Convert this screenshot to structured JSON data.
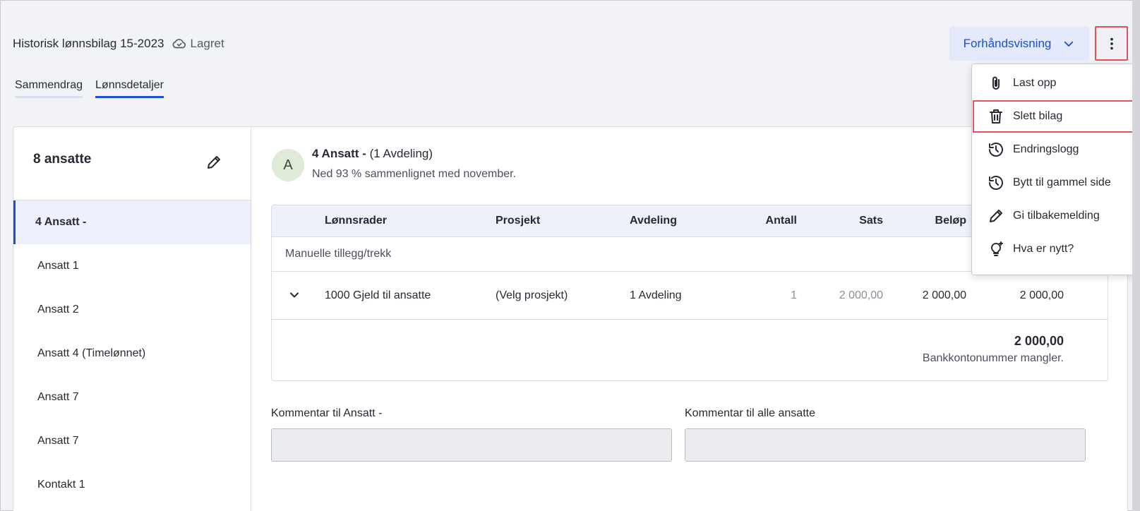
{
  "header": {
    "doc_title": "Historisk lønnsbilag 15-2023",
    "saved_label": "Lagret",
    "preview_label": "Forhåndsvisning"
  },
  "tabs": [
    {
      "label": "Sammendrag",
      "active": false
    },
    {
      "label": "Lønnsdetaljer",
      "active": true
    }
  ],
  "sidebar": {
    "title": "8 ansatte",
    "items": [
      {
        "label": "4 Ansatt -",
        "active": true
      },
      {
        "label": "Ansatt 1"
      },
      {
        "label": "Ansatt 2"
      },
      {
        "label": "Ansatt 4 (Timelønnet)"
      },
      {
        "label": "Ansatt 7"
      },
      {
        "label": "Ansatt 7"
      },
      {
        "label": "Kontakt 1"
      }
    ]
  },
  "employee": {
    "avatar_letter": "A",
    "name": "4 Ansatt -",
    "department": "(1 Avdeling)",
    "subtitle": "Ned 93 % sammenlignet med november."
  },
  "table": {
    "headers": {
      "rows": "Lønnsrader",
      "project": "Prosjekt",
      "department": "Avdeling",
      "amount": "Antall",
      "rate": "Sats",
      "sum": "Beløp"
    },
    "group_label": "Manuelle tillegg/trekk",
    "row": {
      "name": "1000 Gjeld til ansatte",
      "project": "(Velg prosjekt)",
      "department": "1 Avdeling",
      "amount": "1",
      "rate": "2 000,00",
      "sum": "2 000,00",
      "total": "2 000,00"
    },
    "grand_total": "2 000,00",
    "bank_note": "Bankkontonummer mangler."
  },
  "comments": {
    "employee_label": "Kommentar til Ansatt -",
    "all_label": "Kommentar til alle ansatte"
  },
  "menu": {
    "items": [
      {
        "label": "Last opp",
        "icon": "paperclip-icon"
      },
      {
        "label": "Slett bilag",
        "icon": "trash-icon",
        "highlighted": true
      },
      {
        "label": "Endringslogg",
        "icon": "history-icon"
      },
      {
        "label": "Bytt til gammel side",
        "icon": "history-icon"
      },
      {
        "label": "Gi tilbakemelding",
        "icon": "pencil-icon"
      },
      {
        "label": "Hva er nytt?",
        "icon": "lightbulb-icon"
      }
    ]
  },
  "colors": {
    "accent": "#1a4fd6",
    "highlight": "#e0525d",
    "avatar_bg": "#dfead8"
  }
}
